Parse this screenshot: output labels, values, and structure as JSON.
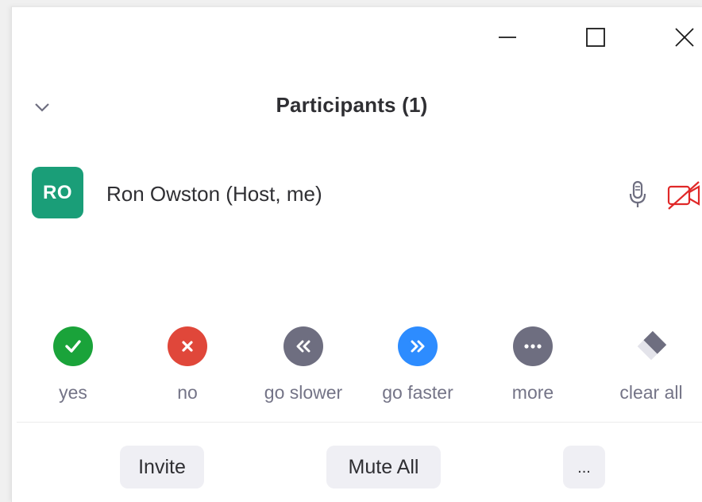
{
  "window_controls": {
    "minimize_icon": "minimize-icon",
    "maximize_icon": "maximize-icon",
    "close_icon": "close-icon"
  },
  "panel": {
    "title": "Participants (1)",
    "collapse_icon": "chevron-down-icon"
  },
  "participants": [
    {
      "initials": "RO",
      "name": "Ron Owston (Host, me)",
      "avatar_color": "#1a9e78",
      "mic_icon": "microphone-icon",
      "video_icon": "video-off-icon",
      "video_icon_color": "#e02828"
    }
  ],
  "feedback": [
    {
      "label": "yes",
      "icon": "check-icon",
      "color": "#1aa33a"
    },
    {
      "label": "no",
      "icon": "x-icon",
      "color": "#e0473a"
    },
    {
      "label": "go slower",
      "icon": "rewind-icon",
      "color": "#6e6e80"
    },
    {
      "label": "go faster",
      "icon": "fast-forward-icon",
      "color": "#2d8cff"
    },
    {
      "label": "more",
      "icon": "ellipsis-icon",
      "color": "#6e6e80"
    },
    {
      "label": "clear all",
      "icon": "eraser-icon",
      "color": "#6e6e80"
    }
  ],
  "actions": {
    "invite_label": "Invite",
    "mute_all_label": "Mute All",
    "more_label": "..."
  }
}
